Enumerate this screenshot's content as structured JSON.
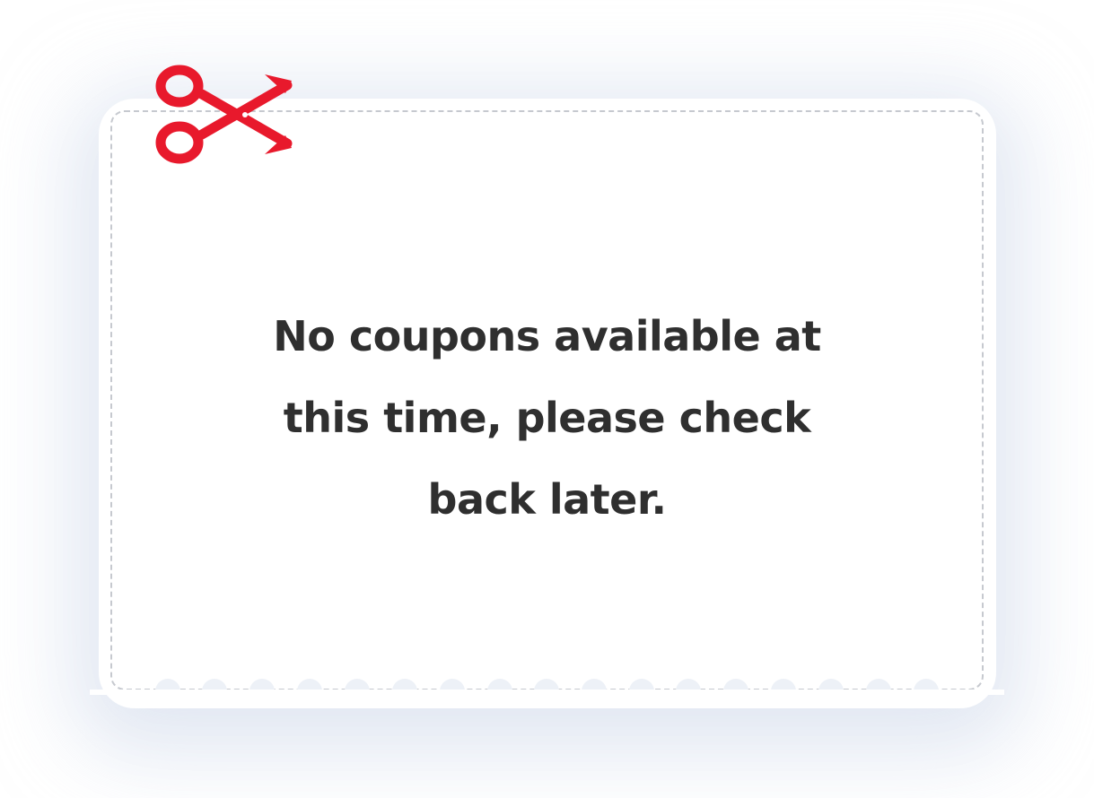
{
  "coupon": {
    "message_lines": [
      "No coupons available at",
      "this time, please check",
      "back later."
    ]
  },
  "icons": {
    "cut": "scissors-icon"
  },
  "colors": {
    "scissors": "#e8192c",
    "text": "#2f2f2f",
    "border": "#c6c9cf",
    "glow": "#c8d4e8"
  }
}
